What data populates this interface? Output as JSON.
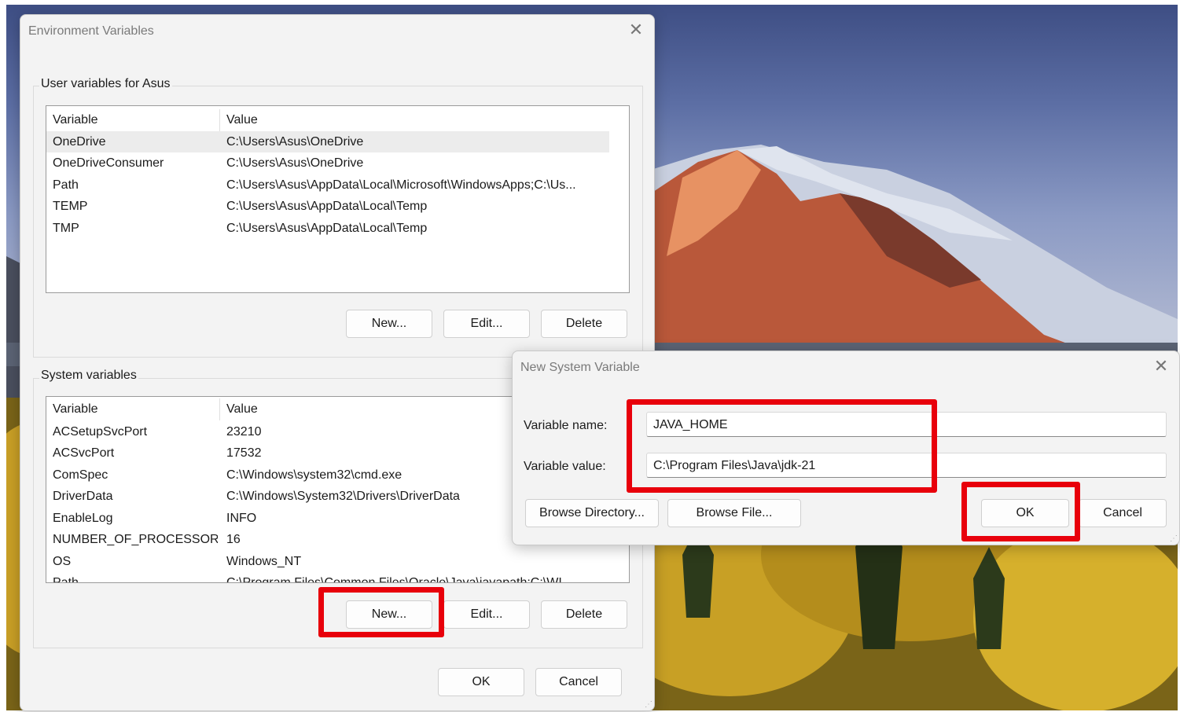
{
  "env_window": {
    "title": "Environment Variables",
    "user_group": {
      "label": "User variables for Asus",
      "headers": {
        "variable": "Variable",
        "value": "Value"
      },
      "rows": [
        {
          "variable": "OneDrive",
          "value": "C:\\Users\\Asus\\OneDrive",
          "selected": true
        },
        {
          "variable": "OneDriveConsumer",
          "value": "C:\\Users\\Asus\\OneDrive"
        },
        {
          "variable": "Path",
          "value": "C:\\Users\\Asus\\AppData\\Local\\Microsoft\\WindowsApps;C:\\Us..."
        },
        {
          "variable": "TEMP",
          "value": "C:\\Users\\Asus\\AppData\\Local\\Temp"
        },
        {
          "variable": "TMP",
          "value": "C:\\Users\\Asus\\AppData\\Local\\Temp"
        }
      ],
      "buttons": {
        "new": "New...",
        "edit": "Edit...",
        "delete": "Delete"
      }
    },
    "system_group": {
      "label": "System variables",
      "headers": {
        "variable": "Variable",
        "value": "Value"
      },
      "rows": [
        {
          "variable": "ACSetupSvcPort",
          "value": "23210"
        },
        {
          "variable": "ACSvcPort",
          "value": "17532"
        },
        {
          "variable": "ComSpec",
          "value": "C:\\Windows\\system32\\cmd.exe"
        },
        {
          "variable": "DriverData",
          "value": "C:\\Windows\\System32\\Drivers\\DriverData"
        },
        {
          "variable": "EnableLog",
          "value": "INFO"
        },
        {
          "variable": "NUMBER_OF_PROCESSORS",
          "value": "16"
        },
        {
          "variable": "OS",
          "value": "Windows_NT"
        },
        {
          "variable": "Path",
          "value": "C:\\Program Files\\Common Files\\Oracle\\Java\\javapath;C:\\WI..."
        }
      ],
      "buttons": {
        "new": "New...",
        "edit": "Edit...",
        "delete": "Delete"
      }
    },
    "ok": "OK",
    "cancel": "Cancel"
  },
  "new_var_dialog": {
    "title": "New System Variable",
    "name_label": "Variable name:",
    "value_label": "Variable value:",
    "name_value": "JAVA_HOME",
    "value_value": "C:\\Program Files\\Java\\jdk-21",
    "browse_directory": "Browse Directory...",
    "browse_file": "Browse File...",
    "ok": "OK",
    "cancel": "Cancel"
  },
  "annotation_color": "#e8000b"
}
